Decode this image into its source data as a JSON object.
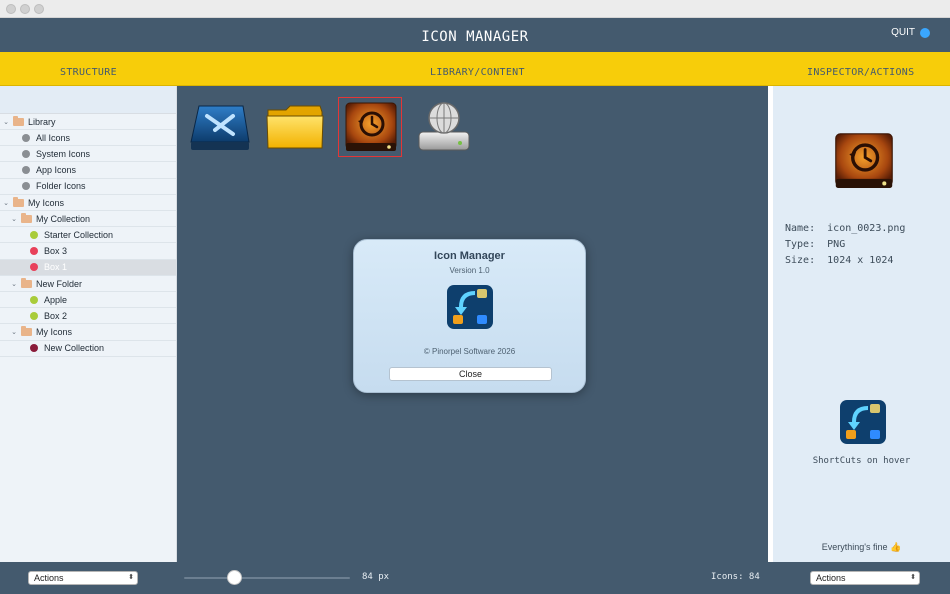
{
  "window": {
    "title": "ICON MANAGER",
    "quit_label": "QUIT",
    "quit_color": "#3aa7ff"
  },
  "columns": {
    "structure": "STRUCTURE",
    "library": "LIBRARY/CONTENT",
    "inspector": "INSPECTOR/ACTIONS"
  },
  "sidebar": {
    "items": [
      {
        "label": "Library",
        "kind": "folder",
        "expanded": true
      },
      {
        "label": "All Icons",
        "kind": "dot",
        "color": "#8a8e93"
      },
      {
        "label": "System Icons",
        "kind": "dot",
        "color": "#8a8e93"
      },
      {
        "label": "App Icons",
        "kind": "dot",
        "color": "#8a8e93"
      },
      {
        "label": "Folder Icons",
        "kind": "dot",
        "color": "#8a8e93"
      },
      {
        "label": "My Icons",
        "kind": "folder",
        "expanded": true
      },
      {
        "label": "My Collection",
        "kind": "folder",
        "expanded": true
      },
      {
        "label": "Starter Collection",
        "kind": "dot",
        "color": "#a9cc3a"
      },
      {
        "label": "Box 3",
        "kind": "dot",
        "color": "#e8405a"
      },
      {
        "label": "Box 1",
        "kind": "dot",
        "color": "#e8405a",
        "selected": true
      },
      {
        "label": "New Folder",
        "kind": "folder",
        "expanded": true
      },
      {
        "label": "Apple",
        "kind": "dot",
        "color": "#a9cc3a"
      },
      {
        "label": "Box 2",
        "kind": "dot",
        "color": "#a9cc3a"
      },
      {
        "label": "My Icons",
        "kind": "folder",
        "expanded": true
      },
      {
        "label": "New Collection",
        "kind": "dot",
        "color": "#8a1b3a"
      }
    ]
  },
  "library": {
    "icons": [
      {
        "icon": "xcode-drive-icon"
      },
      {
        "icon": "yellow-folder-icon"
      },
      {
        "icon": "time-machine-drive-icon",
        "selected": true
      },
      {
        "icon": "network-drive-icon"
      }
    ]
  },
  "about_dialog": {
    "title": "Icon Manager",
    "version": "Version 1.0",
    "copyright": "© Pinorpel Software 2026",
    "close_label": "Close",
    "logo": "icon-manager-app-icon"
  },
  "inspector": {
    "preview_icon": "time-machine-drive-icon",
    "name_label": "Name:",
    "name_value": "icon_0023.png",
    "type_label": "Type:",
    "type_value": "PNG",
    "size_label": "Size:",
    "size_value": "1024 x 1024",
    "shortcut_icon": "icon-manager-app-icon",
    "shortcut_label": "ShortCuts on hover",
    "status": "Everything's fine 👍"
  },
  "bottombar": {
    "left_actions": "Actions",
    "right_actions": "Actions",
    "size_value": "84 px",
    "size_level": 0.3,
    "icons_count": "Icons: 84"
  }
}
